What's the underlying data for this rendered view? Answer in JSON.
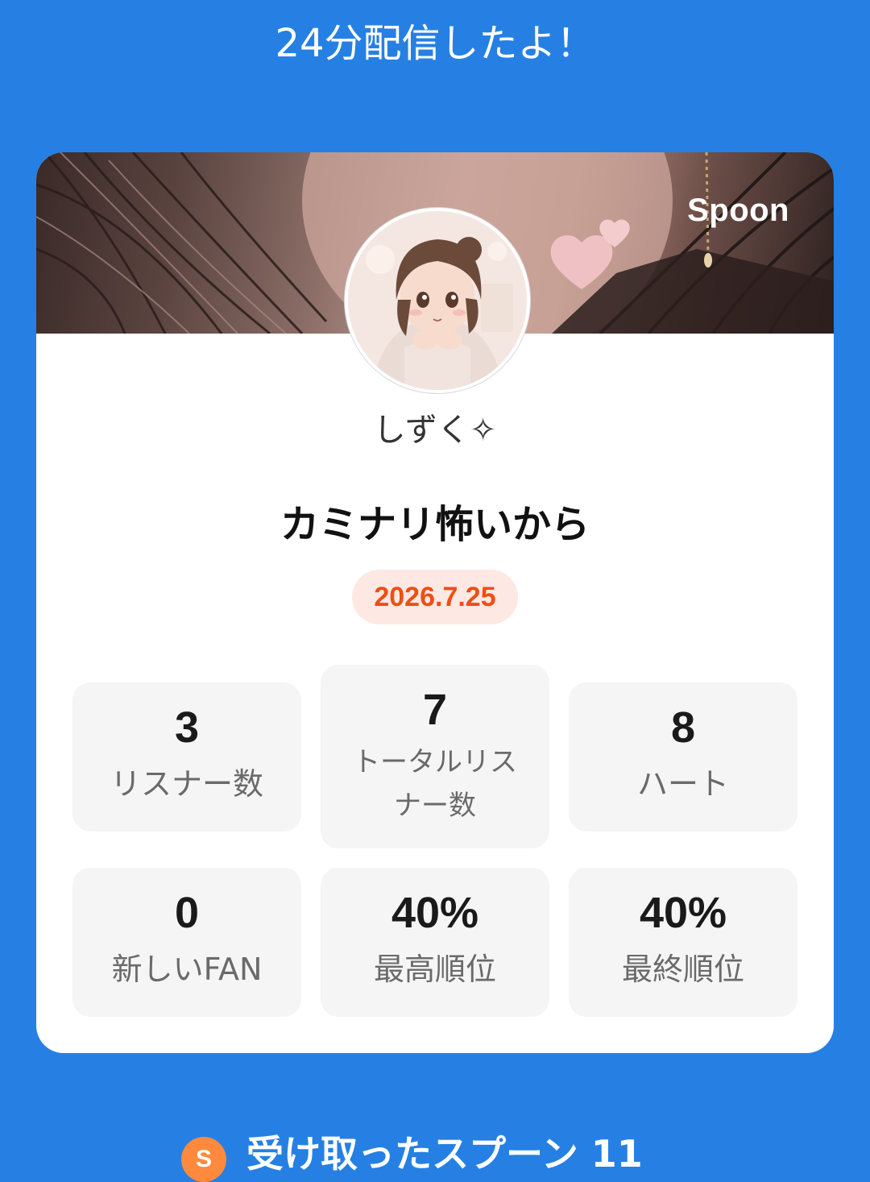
{
  "headline": "24分配信したよ！",
  "card": {
    "brand": "Spoon",
    "streamer_name": "しずく✧",
    "stream_title": "カミナリ怖いから",
    "date": "2026.7.25"
  },
  "stats": [
    {
      "value": "3",
      "label": "リスナー数"
    },
    {
      "value": "7",
      "label": "トータルリスナー数"
    },
    {
      "value": "8",
      "label": "ハート"
    },
    {
      "value": "0",
      "label": "新しいFAN"
    },
    {
      "value": "40%",
      "label": "最高順位"
    },
    {
      "value": "40%",
      "label": "最終順位"
    }
  ],
  "received": {
    "label": "受け取ったスプーン 11",
    "coin_symbol": "S"
  },
  "colors": {
    "background": "#2680e3",
    "date_text": "#ef4e14",
    "date_badge_bg": "#fde8e3",
    "stat_bg": "#f5f5f5",
    "coin": "#ff8a3d"
  }
}
